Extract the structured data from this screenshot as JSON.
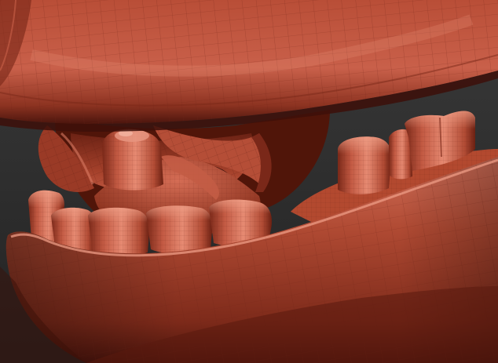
{
  "scene": {
    "subject": "",
    "colors": {
      "background": "#2b2b2b",
      "background_top": "#3a3a3a",
      "clay_base": "#a8422f",
      "clay_light": "#d9735c",
      "clay_highlight": "#efa08a",
      "clay_shadow": "#5a1b12",
      "clay_deep": "#3d0f09",
      "wire": "#7a2a1c"
    }
  }
}
